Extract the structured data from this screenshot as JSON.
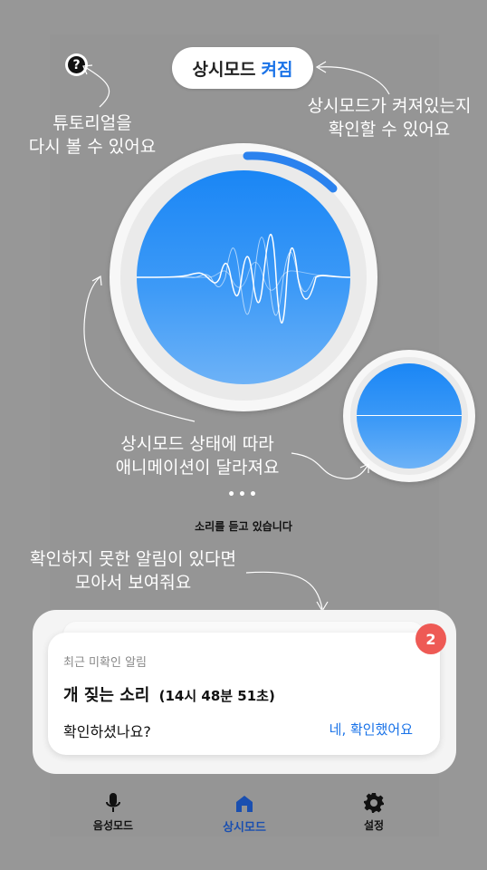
{
  "status": {
    "label": "상시모드",
    "state": "켜짐"
  },
  "help": {
    "icon": "question-icon",
    "glyph": "?"
  },
  "notes": {
    "tutorial_line1": "튜토리얼을",
    "tutorial_line2": "다시 볼 수 있어요",
    "status_line1": "상시모드가 켜져있는지",
    "status_line2": "확인할 수 있어요",
    "anim_line1": "상시모드 상태에 따라",
    "anim_line2": "애니메이션이 달라져요",
    "unread_line1": "확인하지 못한 알림이 있다면",
    "unread_line2": "모아서 보여줘요"
  },
  "dots": "•••",
  "listening_text": "소리를 듣고 있습니다",
  "notification": {
    "header": "최근 미확인 알림",
    "title": "개 짖는 소리",
    "time": "(14시 48분 51초)",
    "question": "확인하셨나요?",
    "confirm_label": "네, 확인했어요",
    "badge_count": "2"
  },
  "nav": {
    "items": [
      {
        "label": "음성모드",
        "icon": "microphone-icon"
      },
      {
        "label": "상시모드",
        "icon": "home-icon",
        "active": true
      },
      {
        "label": "설정",
        "icon": "gear-icon"
      }
    ]
  },
  "colors": {
    "accent": "#1a73e8",
    "badge": "#ee5a55",
    "circle_top": "#1a86f5",
    "circle_bottom": "#6db2f7"
  }
}
